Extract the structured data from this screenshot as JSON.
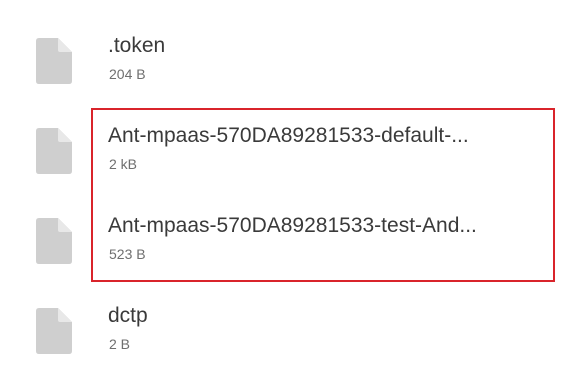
{
  "files": [
    {
      "name": ".token",
      "size": "204 B",
      "icon": "file-icon"
    },
    {
      "name": "Ant-mpaas-570DA89281533-default-...",
      "size": "2 kB",
      "icon": "file-icon"
    },
    {
      "name": "Ant-mpaas-570DA89281533-test-And...",
      "size": "523 B",
      "icon": "file-icon"
    },
    {
      "name": "dctp",
      "size": "2 B",
      "icon": "file-icon"
    }
  ],
  "colors": {
    "icon": "#cfcfcf",
    "highlight_border": "#d9242b",
    "name_text": "#3a3a3a",
    "size_text": "#6f6f6f"
  }
}
